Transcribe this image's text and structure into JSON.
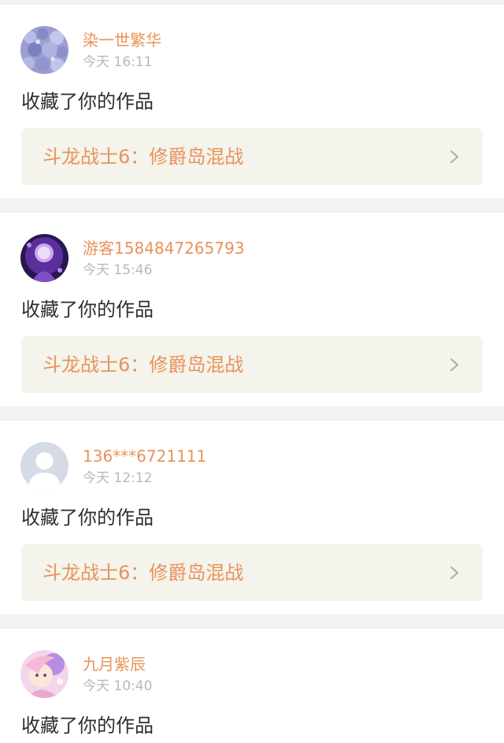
{
  "feed": {
    "items": [
      {
        "username": "染一世繁华",
        "time": "今天 16:11",
        "action": "收藏了你的作品",
        "work_title": "斗龙战士6：修爵岛混战"
      },
      {
        "username": "游客1584847265793",
        "time": "今天 15:46",
        "action": "收藏了你的作品",
        "work_title": "斗龙战士6：修爵岛混战"
      },
      {
        "username": "136***6721111",
        "time": "今天 12:12",
        "action": "收藏了你的作品",
        "work_title": "斗龙战士6：修爵岛混战"
      },
      {
        "username": "九月紫辰",
        "time": "今天 10:40",
        "action": "收藏了你的作品"
      }
    ]
  },
  "icons": {
    "chevron": "chevron-right-icon"
  },
  "colors": {
    "accent": "#e8935a",
    "time": "#b8b8b8",
    "text": "#2e2e2e",
    "link_background": "#f4f3ec",
    "page_background": "#f2f2f2"
  }
}
